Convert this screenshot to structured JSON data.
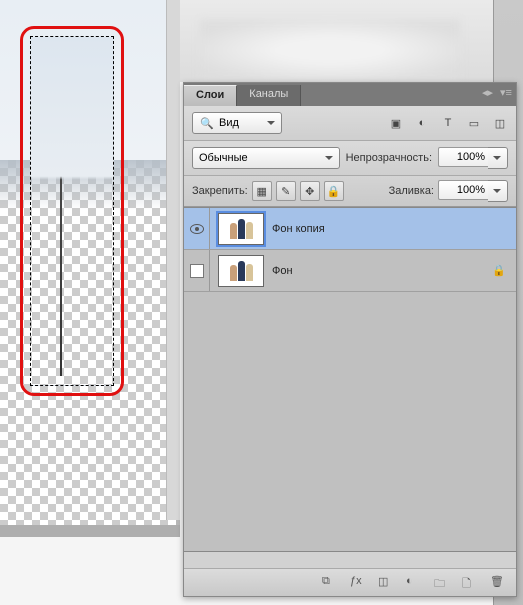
{
  "tabs": {
    "layers": "Слои",
    "channels": "Каналы"
  },
  "filter": {
    "label": "Вид"
  },
  "blend": {
    "mode": "Обычные",
    "opacity_label": "Непрозрачность:",
    "opacity": "100%"
  },
  "lock": {
    "label": "Закрепить:",
    "fill_label": "Заливка:",
    "fill": "100%"
  },
  "layers": [
    {
      "name": "Фон копия",
      "visible": true,
      "locked": false,
      "selected": true
    },
    {
      "name": "Фон",
      "visible": false,
      "locked": true,
      "selected": false
    }
  ],
  "icons": {
    "filter": "▣",
    "adjust": "◐",
    "text": "T",
    "crop": "▭",
    "mask": "◫",
    "pixels": "▦",
    "brush": "✎",
    "move": "✥",
    "lock": "🔒",
    "link": "⧉",
    "fx": "ƒx",
    "maskF": "◫",
    "fill": "◐",
    "group": "🗀",
    "new": "🗋",
    "trash": "🗑"
  }
}
